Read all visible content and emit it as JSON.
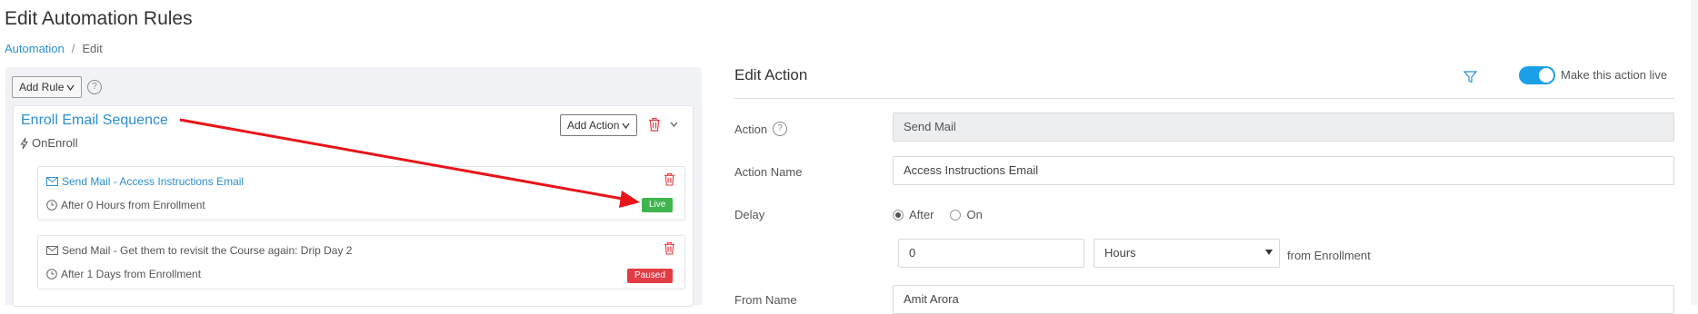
{
  "page": {
    "title": "Edit Automation Rules",
    "breadcrumb": {
      "link": "Automation",
      "separator": "/",
      "current": "Edit"
    }
  },
  "left": {
    "add_rule_label": "Add Rule",
    "help_glyph": "?",
    "rule": {
      "title": "Enroll Email Sequence",
      "trigger": "OnEnroll",
      "add_action_label": "Add Action",
      "actions": [
        {
          "title": "Send Mail - Access Instructions Email",
          "delay": "After 0 Hours from Enrollment",
          "status": "Live"
        },
        {
          "title": "Send Mail - Get them to revisit the Course again: Drip Day 2",
          "delay": "After 1 Days from Enrollment",
          "status": "Paused"
        }
      ]
    }
  },
  "right": {
    "title": "Edit Action",
    "toggle_label": "Make this action live",
    "toggle_on": true,
    "action_label": "Action",
    "action_value": "Send Mail",
    "action_name_label": "Action Name",
    "action_name_value": "Access Instructions Email",
    "delay_label": "Delay",
    "delay_options": [
      "After",
      "On"
    ],
    "delay_selected": "After",
    "delay_amount": "0",
    "delay_unit": "Hours",
    "delay_suffix": "from Enrollment",
    "from_name_label": "From Name",
    "from_name_value": "Amit Arora"
  },
  "colors": {
    "link": "#2b8fcf",
    "live": "#3fb54e",
    "paused": "#e23c45",
    "toggle": "#1aa0e6",
    "annotation_arrow": "#e8141a"
  },
  "icons": [
    "help-icon",
    "lightning-icon",
    "trash-icon",
    "chevron-down-icon",
    "mail-icon",
    "clock-icon",
    "filter-icon",
    "caret-down-icon"
  ]
}
